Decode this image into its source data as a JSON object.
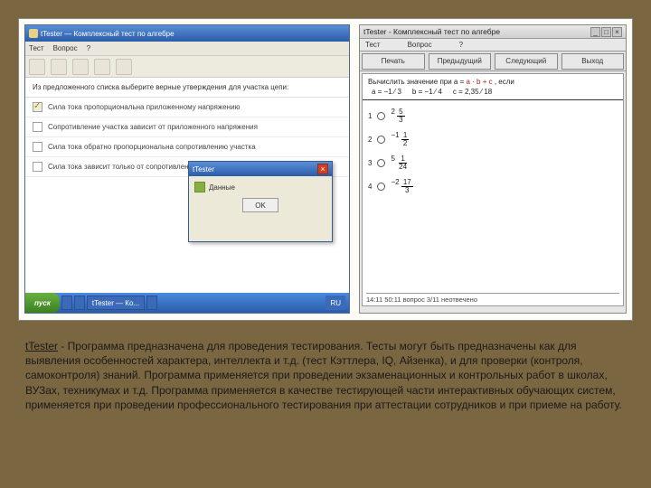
{
  "left": {
    "title": "tTester — Комплексный тест по алгебре",
    "menu": [
      "Тест",
      "Вопрос",
      "?"
    ],
    "question_header": "Из предложенного списка выберите верные утверждения для участка цепи:",
    "options": [
      {
        "checked": true,
        "text": "Сила тока пропорциональна приложенному напряжению"
      },
      {
        "checked": false,
        "text": "Сопротивление участка зависит от приложенного напряжения"
      },
      {
        "checked": false,
        "text": "Сила тока обратно пропорциональна сопротивлению участка"
      },
      {
        "checked": false,
        "text": "Сила тока зависит только от сопротивления участка"
      }
    ],
    "dialog": {
      "title": "tTester",
      "msg": "Данные",
      "btn": "OK",
      "close": "×"
    },
    "taskbar": {
      "start": "пуск",
      "items": [
        "",
        "",
        "tTester — Ко...",
        ""
      ],
      "tray": "RU"
    }
  },
  "right": {
    "title": "tTester - Комплексный тест по алгебре",
    "win_btns": [
      "_",
      "□",
      "×"
    ],
    "subbar": [
      "Тест",
      "Вопрос",
      "?"
    ],
    "buttons": [
      "Печать",
      "Предыдущий",
      "Следующий",
      "Выход"
    ],
    "question_pre": "Вычислить значение при a = ",
    "question_hl": "a · b + c",
    "question_post": ", если",
    "formula": [
      "a = −1 ⁄ 3",
      "b = −1 ⁄ 4",
      "c = 2,35 ⁄ 18"
    ],
    "opts": [
      {
        "n": "1",
        "whole": "2",
        "num": "5",
        "den": "3"
      },
      {
        "n": "2",
        "whole": "−1",
        "num": "1",
        "den": "2"
      },
      {
        "n": "3",
        "whole": "5",
        "num": "1",
        "den": "24"
      },
      {
        "n": "4",
        "whole": "−2",
        "num": "17",
        "den": "3"
      }
    ],
    "status": "14:11   50:11   вопрос 3/11   неотвечено"
  },
  "desc": {
    "name": "tTester",
    "text": " - Программа предназначена для проведения тестирования. Тесты могут быть предназначены как для выявления особенностей характера, интеллекта и т.д. (тест Кэттлера, IQ, Айзенка), и для проверки (контроля, самоконтроля) знаний. Программа применяется при проведении экзаменационных и контрольных работ в школах, ВУЗах, техникумах и т.д. Программа применяется в качестве тестирующей части интерактивных обучающих систем, применяется при проведении профессионального тестирования при аттестации сотрудников и при приеме на работу."
  }
}
